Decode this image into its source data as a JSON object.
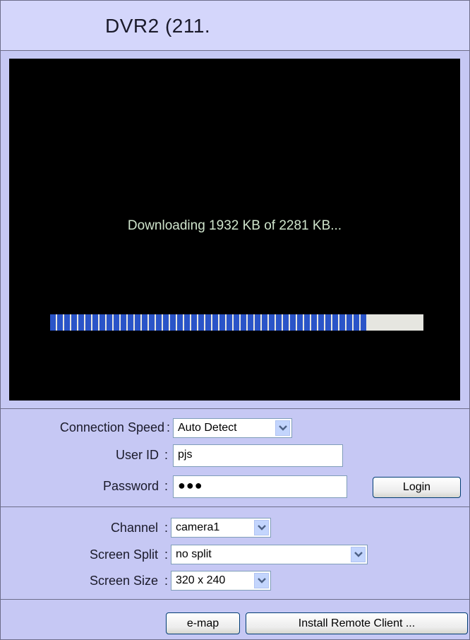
{
  "window": {
    "title": "DVR2 (211."
  },
  "viewer": {
    "status_text": "Downloading 1932 KB of 2281 KB...",
    "progress_fraction": 0.847,
    "progress_color": "#2a54c8"
  },
  "connection": {
    "speed_label": "Connection Speed",
    "speed_separator": ":",
    "speed_value": "Auto Detect",
    "user_id_label": "User ID",
    "user_id_separator": ":",
    "user_id_value": "pjs",
    "password_label": "Password",
    "password_separator": ":",
    "password_masked": "●●●",
    "login_label": "Login"
  },
  "view": {
    "channel_label": "Channel",
    "channel_separator": ":",
    "channel_value": "camera1",
    "split_label": "Screen Split",
    "split_separator": ":",
    "split_value": "no split",
    "size_label": "Screen Size",
    "size_separator": ":",
    "size_value": "320 x 240"
  },
  "footer": {
    "emap_label": "e-map",
    "install_label": "Install Remote Client ..."
  },
  "colors": {
    "panel_bg": "#c6c8f4",
    "title_bg": "#d4d6fb",
    "video_bg": "#000000"
  }
}
